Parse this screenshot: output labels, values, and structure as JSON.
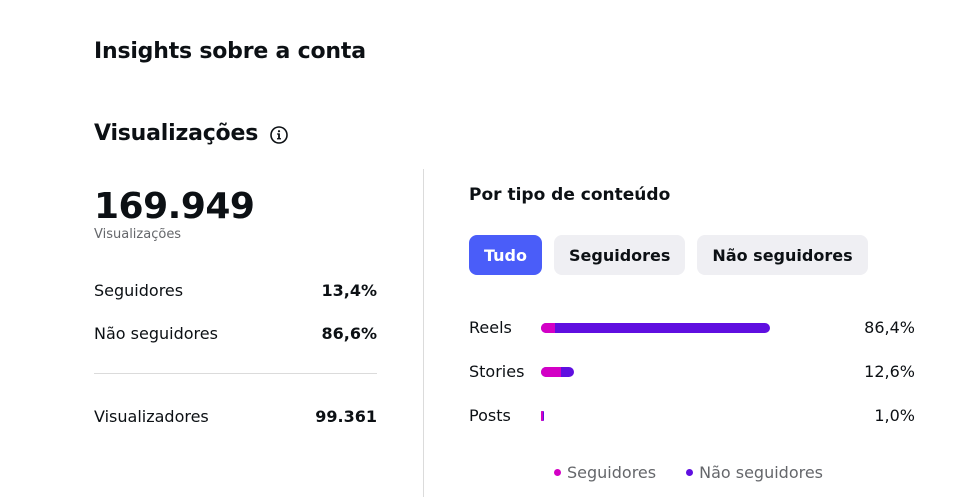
{
  "header": {
    "title": "Insights sobre a conta"
  },
  "section": {
    "title": "Visualizações",
    "info_icon": "info-circle-icon"
  },
  "summary": {
    "total_views": "169.949",
    "total_views_label": "Visualizações",
    "rows": [
      {
        "label": "Seguidores",
        "value": "13,4%"
      },
      {
        "label": "Não seguidores",
        "value": "86,6%"
      }
    ],
    "viewers": {
      "label": "Visualizadores",
      "value": "99.361"
    }
  },
  "content_type": {
    "title": "Por tipo de conteúdo",
    "tabs": [
      {
        "label": "Tudo",
        "active": true
      },
      {
        "label": "Seguidores",
        "active": false
      },
      {
        "label": "Não seguidores",
        "active": false
      }
    ]
  },
  "chart_data": {
    "type": "bar",
    "orientation": "horizontal",
    "stacked": true,
    "categories": [
      "Reels",
      "Stories",
      "Posts"
    ],
    "totals": [
      86.4,
      12.6,
      1.0
    ],
    "value_labels": [
      "86,4%",
      "12,6%",
      "1,0%"
    ],
    "series": [
      {
        "name": "Seguidores",
        "color": "#d300c5",
        "share_of_bar": [
          0.06,
          0.6,
          0.5
        ]
      },
      {
        "name": "Não seguidores",
        "color": "#5f0fe0"
      }
    ],
    "legend_position": "bottom"
  }
}
